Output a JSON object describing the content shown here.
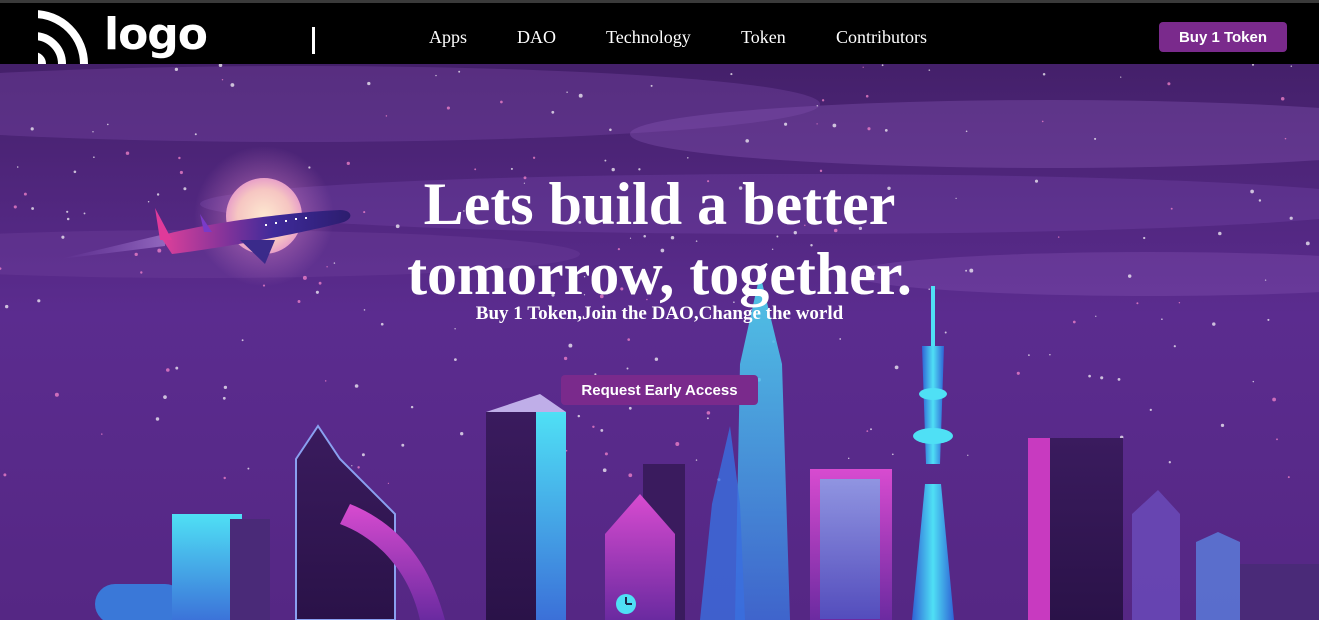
{
  "brand": {
    "logo_text": "logo"
  },
  "nav": {
    "links": [
      {
        "label": "Apps"
      },
      {
        "label": "DAO"
      },
      {
        "label": "Technology"
      },
      {
        "label": "Token"
      },
      {
        "label": "Contributors"
      }
    ],
    "buy_label": "Buy 1 Token"
  },
  "hero": {
    "title_line1": "Lets build a better",
    "title_line2": "tomorrow, together.",
    "subtitle": "Buy 1 Token,Join the DAO,Change the world",
    "cta_label": "Request Early Access"
  },
  "colors": {
    "nav_bg": "#000000",
    "accent_button": "#7a2a8c",
    "sky_top": "#4a2571",
    "sky_bottom": "#5a2b8e",
    "neon_cyan": "#3fd2f0",
    "neon_pink": "#e040c8"
  },
  "icons": {
    "logo_mark": "signal-arcs-icon",
    "illustration": "neon-city-skyline-with-airplane"
  }
}
